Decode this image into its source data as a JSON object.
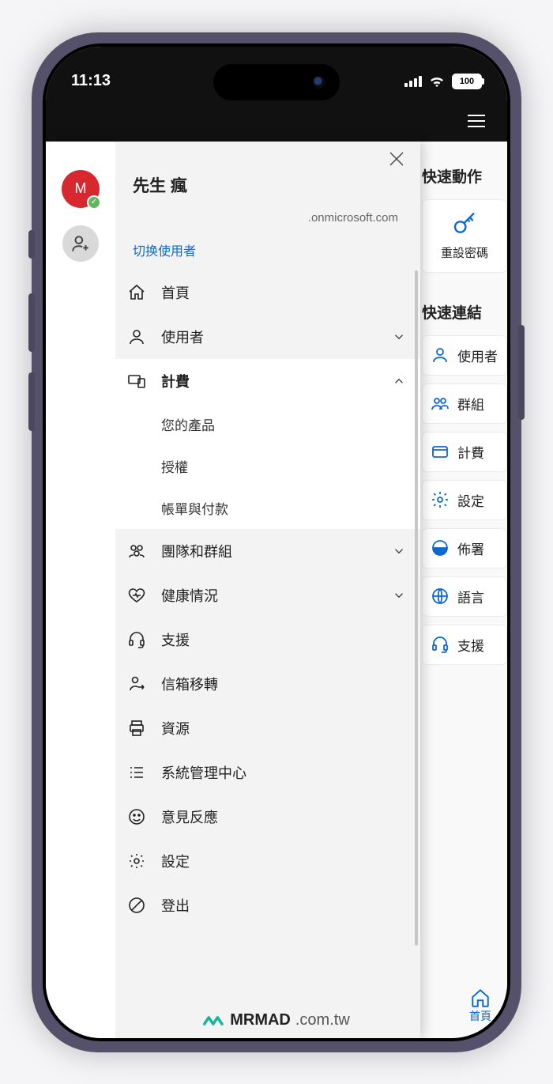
{
  "status": {
    "time": "11:13",
    "battery": "100"
  },
  "profile": {
    "initial": "M",
    "name": "先生 瘋",
    "domain": ".onmicrosoft.com",
    "switch_user": "切换使用者"
  },
  "menu": {
    "home": "首頁",
    "users": "使用者",
    "billing": {
      "label": "計費",
      "items": [
        "您的產品",
        "授權",
        "帳單與付款"
      ]
    },
    "teams": "團隊和群組",
    "health": "健康情況",
    "support": "支援",
    "migration": "信箱移轉",
    "resources": "資源",
    "admin_centers": "系統管理中心",
    "feedback": "意見反應",
    "settings": "設定",
    "signout": "登出"
  },
  "underlay": {
    "quick_actions_title": "快速動作",
    "reset_password": "重設密碼",
    "quick_links_title": "快速連結",
    "links": {
      "users": "使用者",
      "groups": "群組",
      "billing": "計費",
      "settings": "設定",
      "deploy": "佈署",
      "language": "語言",
      "support": "支援"
    },
    "home_tab": "首頁"
  },
  "watermark": {
    "brand": "MRMAD",
    "suffix": ".com.tw"
  }
}
